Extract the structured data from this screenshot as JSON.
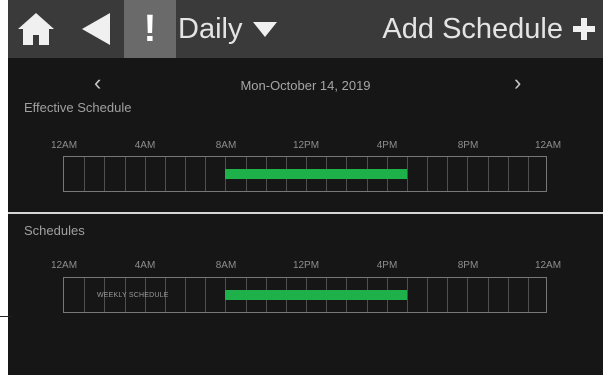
{
  "topbar": {
    "home_icon": "home-icon",
    "back_icon": "back-arrow-icon",
    "alert_label": "!",
    "period_label": "Daily",
    "period_icon": "caret-down-icon",
    "add_label": "Add Schedule",
    "add_icon": "plus-icon"
  },
  "date_nav": {
    "prev": "‹",
    "date": "Mon-October 14, 2019",
    "next": "›"
  },
  "effective": {
    "title": "Effective Schedule",
    "ticks": [
      "12AM",
      "4AM",
      "8AM",
      "12PM",
      "4PM",
      "8PM",
      "12AM"
    ],
    "active_start_hour": 8,
    "active_end_hour": 17
  },
  "schedules": {
    "title": "Schedules",
    "ticks": [
      "12AM",
      "4AM",
      "8AM",
      "12PM",
      "4PM",
      "8PM",
      "12AM"
    ],
    "items": [
      {
        "name": "WEEKLY SCHEDULE",
        "active_start_hour": 8,
        "active_end_hour": 17
      }
    ]
  },
  "colors": {
    "active_bar": "#1fb149",
    "topbar": "#3a3a3a",
    "background": "#161616"
  }
}
